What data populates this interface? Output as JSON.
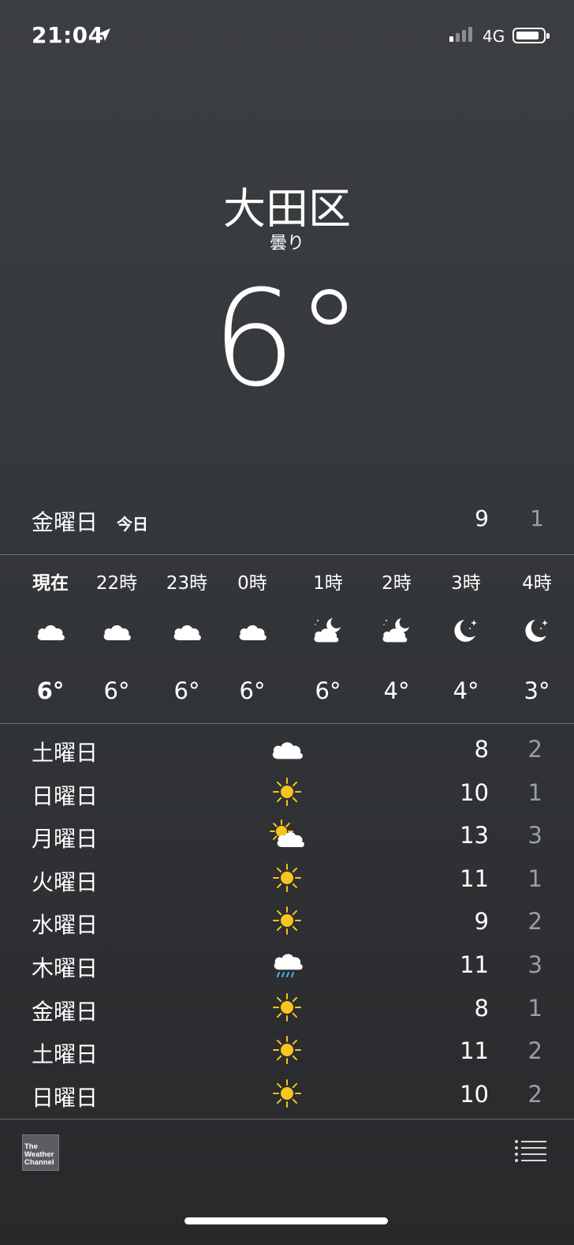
{
  "status_bar": {
    "time": "21:04",
    "network": "4G"
  },
  "location": {
    "city": "大田区",
    "condition": "曇り",
    "temperature": "6°"
  },
  "today": {
    "day": "金曜日",
    "tag": "今日",
    "high": "9",
    "low": "1"
  },
  "hourly": [
    {
      "label": "現在",
      "icon": "cloud-icon",
      "temp": "6°"
    },
    {
      "label": "22時",
      "icon": "cloud-icon",
      "temp": "6°"
    },
    {
      "label": "23時",
      "icon": "cloud-icon",
      "temp": "6°"
    },
    {
      "label": "0時",
      "icon": "cloud-icon",
      "temp": "6°"
    },
    {
      "label": "1時",
      "icon": "cloud-moon-icon",
      "temp": "6°"
    },
    {
      "label": "2時",
      "icon": "cloud-moon-icon",
      "temp": "4°"
    },
    {
      "label": "3時",
      "icon": "moon-stars-icon",
      "temp": "4°"
    },
    {
      "label": "4時",
      "icon": "moon-stars-icon",
      "temp": "3°"
    }
  ],
  "daily": [
    {
      "day": "土曜日",
      "icon": "cloud-icon",
      "high": "8",
      "low": "2"
    },
    {
      "day": "日曜日",
      "icon": "sun-icon",
      "high": "10",
      "low": "1"
    },
    {
      "day": "月曜日",
      "icon": "sun-cloud-icon",
      "high": "13",
      "low": "3"
    },
    {
      "day": "火曜日",
      "icon": "sun-icon",
      "high": "11",
      "low": "1"
    },
    {
      "day": "水曜日",
      "icon": "sun-icon",
      "high": "9",
      "low": "2"
    },
    {
      "day": "木曜日",
      "icon": "rain-cloud-icon",
      "high": "11",
      "low": "3"
    },
    {
      "day": "金曜日",
      "icon": "sun-icon",
      "high": "8",
      "low": "1"
    },
    {
      "day": "土曜日",
      "icon": "sun-icon",
      "high": "11",
      "low": "2"
    },
    {
      "day": "日曜日",
      "icon": "sun-icon",
      "high": "10",
      "low": "2"
    }
  ],
  "footer": {
    "logo_lines": [
      "The",
      "Weather",
      "Channel"
    ]
  },
  "colors": {
    "sun": "#f7c51e",
    "rain": "#4fb3e8",
    "low_temp": "#9b9ea2"
  }
}
